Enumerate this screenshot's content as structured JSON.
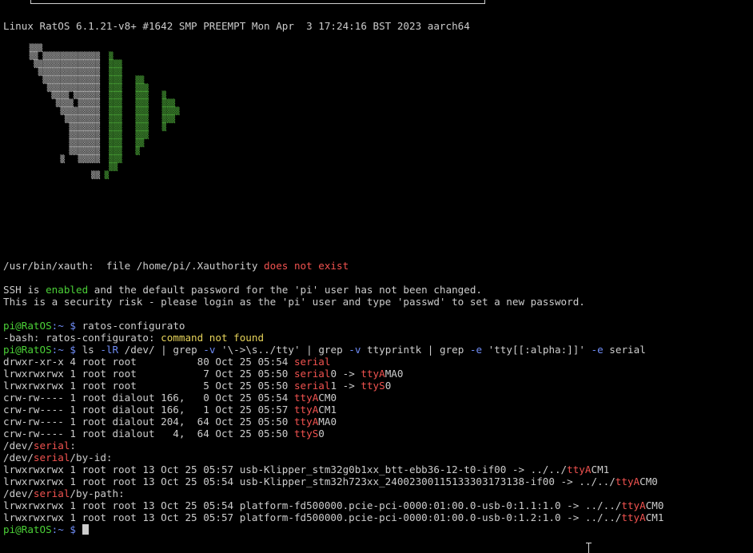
{
  "terminal": {
    "uname": "Linux RatOS 6.1.21-v8+ #1642 SMP PREEMPT Mon Apr  3 17:24:16 BST 2023 aarch64",
    "logo_rows": [
      {
        "w": "   ▒▒▒",
        "g": ""
      },
      {
        "w": "   ▒▒ ▒▒▒▒▒▒▒▒▒▒▒▒▒",
        "g": "  ▒"
      },
      {
        "w": "    ▒▒▒▒▒▒▒▒▒▒▒▒▒▒▒",
        "g": "  ▒▒▒"
      },
      {
        "w": "     ▒▒▒▒▒▒▒▒▒▒▒▒▒▒",
        "g": "  ▒▒▒"
      },
      {
        "w": "      ▒▒▒▒▒▒▒▒▒▒▒▒▒",
        "g": "  ▒▒▒   ▒▒"
      },
      {
        "w": "       ▒▒▒▒▒▒▒▒▒▒▒▒",
        "g": "  ▒▒▒   ▒▒▒"
      },
      {
        "w": "        ▒▒▒▒ ▒▒▒▒▒▒",
        "g": "  ▒▒▒   ▒▒▒   ▒"
      },
      {
        "w": "         ▒▒▒▒ ▒▒▒▒▒",
        "g": "  ▒▒▒   ▒▒▒   ▒▒▒"
      },
      {
        "w": "          ▒▒▒▒▒▒▒▒▒",
        "g": "  ▒▒▒   ▒▒▒   ▒▒▒▒"
      },
      {
        "w": "           ▒▒▒▒▒▒▒▒",
        "g": "  ▒▒▒   ▒▒▒   ▒▒▒"
      },
      {
        "w": "            ▒▒▒▒▒▒▒",
        "g": "  ▒▒▒   ▒▒▒   ▒"
      },
      {
        "w": "            ▒▒▒▒▒▒▒",
        "g": "  ▒▒▒   ▒▒▒"
      },
      {
        "w": "            ▒▒▒▒▒▒▒",
        "g": "  ▒▒▒   ▒▒"
      },
      {
        "w": "            ▒▒▒▒▒▒▒",
        "g": "  ▒▒▒   ▒"
      },
      {
        "w": "          ▒   ▒▒▒▒▒",
        "g": "  ▒▒▒"
      },
      {
        "w": "                   ",
        "g": "  ▒▒"
      },
      {
        "w": "                 ▒▒",
        "g": " ▒"
      }
    ],
    "xauth_prefix": "/usr/bin/xauth:  file /home/pi/.Xauthority ",
    "xauth_error": "does not exist",
    "ssh_1a": "SSH is ",
    "ssh_1b": "enabled",
    "ssh_1c": " and the default password for the 'pi' user has not been changed.",
    "ssh_2": "This is a security risk - please login as the 'pi' user and type 'passwd' to set a new password.",
    "prompt_user": "pi@RatOS",
    "prompt_path": ":~ $ ",
    "cmd1": "ratos-configurato",
    "bash_err_a": "-bash: ratos-configurato: ",
    "bash_err_b": "command not found",
    "cmd2_a": "ls ",
    "cmd2_b": "-lR",
    "cmd2_c": " /dev/ | grep ",
    "cmd2_d": "-v",
    "cmd2_e": " '\\->\\s../tty' | grep ",
    "cmd2_f": "-v",
    "cmd2_g": " ttyprintk | grep ",
    "cmd2_h": "-e",
    "cmd2_i": " 'tty[[:alpha:]]' ",
    "cmd2_j": "-e",
    "cmd2_k": " serial",
    "ls_rows": [
      {
        "pre": "drwxr-xr-x 4 root root          80 Oct 25 05:54 ",
        "hl": "serial",
        "rest": ""
      },
      {
        "pre": "lrwxrwxrwx 1 root root           7 Oct 25 05:50 ",
        "hl": "serial",
        "rest": "0 -> ",
        "hl2": "ttyA",
        "rest2": "MA0"
      },
      {
        "pre": "lrwxrwxrwx 1 root root           5 Oct 25 05:50 ",
        "hl": "serial",
        "rest": "1 -> ",
        "hl2": "ttyS",
        "rest2": "0"
      },
      {
        "pre": "crw-rw---- 1 root dialout 166,   0 Oct 25 05:54 ",
        "hl": "ttyA",
        "rest": "CM0"
      },
      {
        "pre": "crw-rw---- 1 root dialout 166,   1 Oct 25 05:57 ",
        "hl": "ttyA",
        "rest": "CM1"
      },
      {
        "pre": "crw-rw---- 1 root dialout 204,  64 Oct 25 05:50 ",
        "hl": "ttyA",
        "rest": "MA0"
      },
      {
        "pre": "crw-rw---- 1 root dialout   4,  64 Oct 25 05:50 ",
        "hl": "ttyS",
        "rest": "0"
      }
    ],
    "dev_prefix": "/dev/",
    "serial_word": "serial",
    "serial_colon": ":",
    "by_id_suffix": "/by-id:",
    "by_path_suffix": "/by-path:",
    "by_id_rows": [
      {
        "pre": "lrwxrwxrwx 1 root root 13 Oct 25 05:57 usb-Klipper_stm32g0b1xx_btt-ebb36-12-t0-if00 -> ../../",
        "hl": "ttyA",
        "rest": "CM1"
      },
      {
        "pre": "lrwxrwxrwx 1 root root 13 Oct 25 05:54 usb-Klipper_stm32h723xx_24002300115133303173138-if00 -> ../../",
        "hl": "ttyA",
        "rest": "CM0"
      }
    ],
    "by_path_rows": [
      {
        "pre": "lrwxrwxrwx 1 root root 13 Oct 25 05:54 platform-fd500000.pcie-pci-0000:01:00.0-usb-0:1.1:1.0 -> ../../",
        "hl": "ttyA",
        "rest": "CM0"
      },
      {
        "pre": "lrwxrwxrwx 1 root root 13 Oct 25 05:57 platform-fd500000.pcie-pci-0000:01:00.0-usb-0:1.2:1.0 -> ../../",
        "hl": "ttyA",
        "rest": "CM1"
      }
    ]
  }
}
